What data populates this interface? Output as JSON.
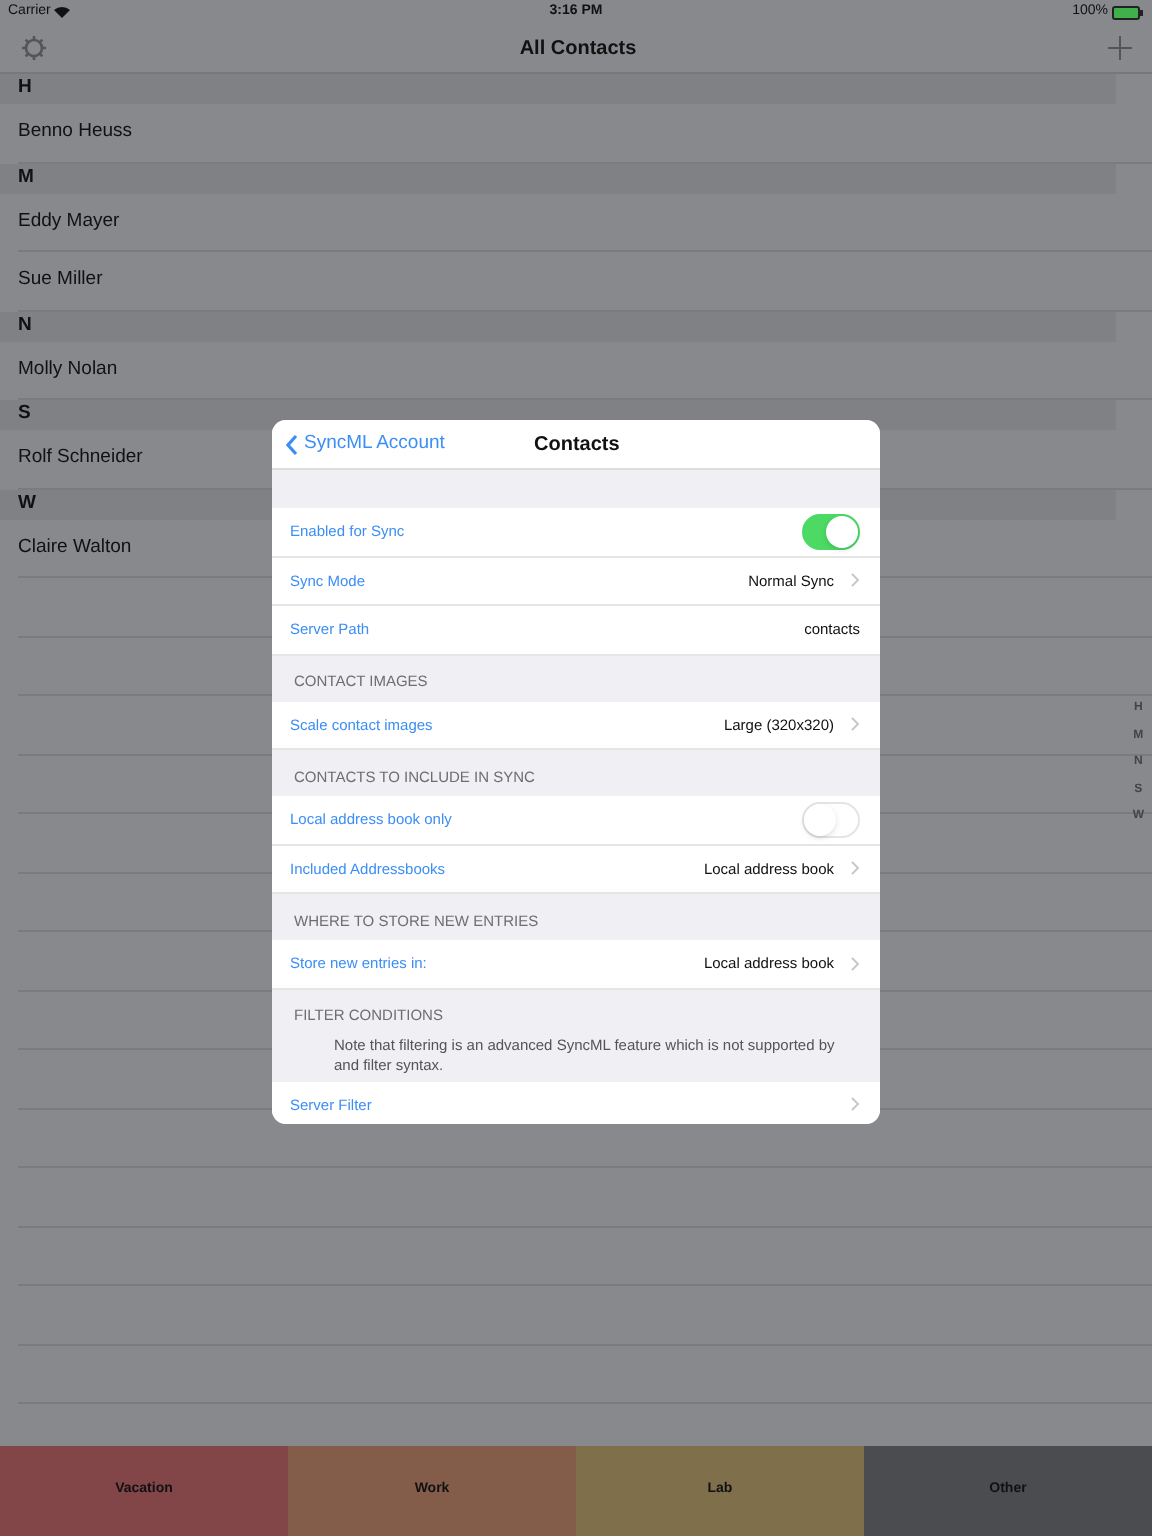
{
  "status_bar": {
    "carrier": "Carrier",
    "time": "3:16 PM",
    "battery": "100%"
  },
  "nav": {
    "title": "All Contacts"
  },
  "contacts": [
    {
      "kind": "section",
      "text": "H"
    },
    {
      "kind": "contact",
      "text": "Benno Heuss"
    },
    {
      "kind": "section",
      "text": "M"
    },
    {
      "kind": "contact",
      "text": "Eddy Mayer"
    },
    {
      "kind": "contact",
      "text": "Sue Miller"
    },
    {
      "kind": "section",
      "text": "N"
    },
    {
      "kind": "contact",
      "text": "Molly Nolan"
    },
    {
      "kind": "section",
      "text": "S"
    },
    {
      "kind": "contact",
      "text": "Rolf Schneider"
    },
    {
      "kind": "section",
      "text": "W"
    },
    {
      "kind": "contact",
      "text": "Claire Walton"
    }
  ],
  "index": [
    "H",
    "M",
    "N",
    "S",
    "W"
  ],
  "tabs": [
    {
      "label": "Vacation",
      "color": "#824649"
    },
    {
      "label": "Work",
      "color": "#835c4a"
    },
    {
      "label": "Lab",
      "color": "#7f6f4a"
    },
    {
      "label": "Other",
      "color": "#4b4c50"
    }
  ],
  "dialog": {
    "back": "SyncML Account",
    "title": "Contacts",
    "sections": [
      {
        "rows": [
          {
            "kind": "switch",
            "label": "Enabled for Sync",
            "on": true
          },
          {
            "kind": "disclosure",
            "label": "Sync Mode",
            "value": "Normal Sync"
          },
          {
            "kind": "value",
            "label": "Server Path",
            "value": "contacts"
          }
        ]
      },
      {
        "header": "CONTACT IMAGES",
        "rows": [
          {
            "kind": "disclosure",
            "label": "Scale contact images",
            "value": "Large (320x320)"
          }
        ]
      },
      {
        "header": "CONTACTS TO INCLUDE IN SYNC",
        "rows": [
          {
            "kind": "switch",
            "label": "Local address book only",
            "on": false
          },
          {
            "kind": "disclosure",
            "label": "Included Addressbooks",
            "value": "Local address book"
          }
        ]
      },
      {
        "header": "WHERE TO STORE NEW ENTRIES",
        "rows": [
          {
            "kind": "disclosure",
            "label": "Store new entries in:",
            "value": "Local address book"
          }
        ]
      },
      {
        "header": "FILTER CONDITIONS",
        "note": [
          "Note that filtering is an advanced SyncML feature which is not supported by",
          "and filter syntax."
        ],
        "rows": [
          {
            "kind": "disclosure",
            "label": "Server Filter"
          }
        ]
      }
    ]
  }
}
